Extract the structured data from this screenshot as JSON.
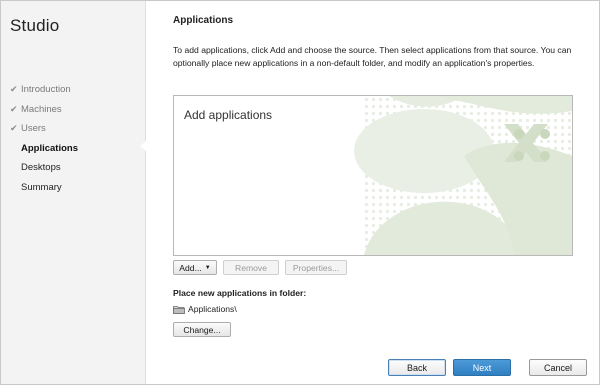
{
  "sidebar": {
    "title": "Studio",
    "steps": [
      {
        "label": "Introduction",
        "state": "done"
      },
      {
        "label": "Machines",
        "state": "done"
      },
      {
        "label": "Users",
        "state": "done"
      },
      {
        "label": "Applications",
        "state": "active"
      },
      {
        "label": "Desktops",
        "state": "pending"
      },
      {
        "label": "Summary",
        "state": "pending"
      }
    ]
  },
  "main": {
    "title": "Applications",
    "intro": "To add applications, click Add and choose the source. Then select applications from that source. You can optionally place new applications in a non-default folder, and modify an application's properties.",
    "pane_heading": "Add applications",
    "toolbar": {
      "add_label": "Add...",
      "remove_label": "Remove",
      "properties_label": "Properties..."
    },
    "folder_label": "Place new applications in folder:",
    "folder_path": "Applications\\",
    "change_label": "Change..."
  },
  "footer": {
    "back_label": "Back",
    "next_label": "Next",
    "cancel_label": "Cancel"
  },
  "colors": {
    "accent": "#3a8bcb",
    "sidebar_bg": "#f3f3f3",
    "watermark": "#dfe8d6"
  }
}
